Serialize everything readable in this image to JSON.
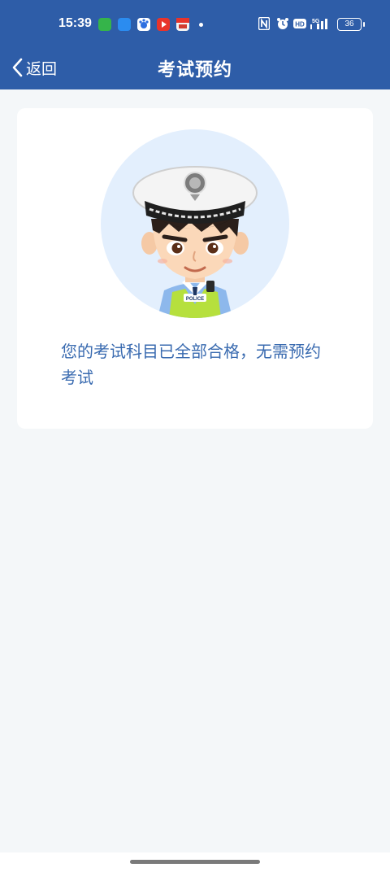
{
  "status_bar": {
    "time": "15:39",
    "battery_level": "36",
    "notification_icons": [
      "wechat-green-icon",
      "blue-app-icon",
      "baidu-icon",
      "video-play-icon",
      "calendar-red-icon"
    ],
    "system_icons": [
      "nfc-icon",
      "alarm-icon",
      "hd-icon",
      "5g-signal-icon",
      "battery-icon"
    ]
  },
  "nav": {
    "back_label": "返回",
    "title": "考试预约"
  },
  "card": {
    "message": "您的考试科目已全部合格，无需预约考试",
    "avatar_badge": "POLICE"
  },
  "colors": {
    "header_bg": "#2e5da8",
    "page_bg": "#f4f7f9",
    "message_text": "#3a6bb0",
    "avatar_circle": "#e3effd"
  }
}
